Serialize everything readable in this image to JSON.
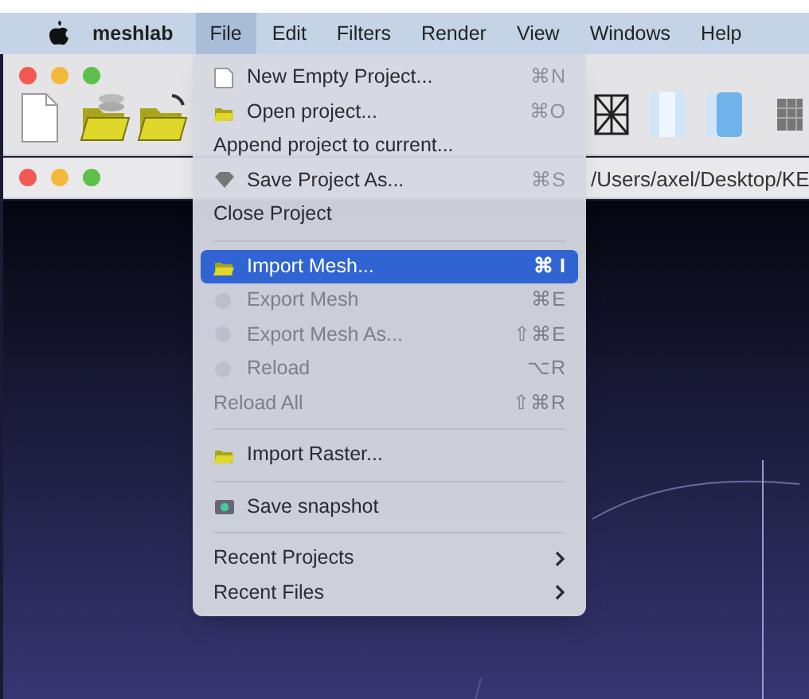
{
  "menu_bar": {
    "app_name": "meshlab",
    "items": [
      {
        "label": "File",
        "selected": true
      },
      {
        "label": "Edit",
        "selected": false
      },
      {
        "label": "Filters",
        "selected": false
      },
      {
        "label": "Render",
        "selected": false
      },
      {
        "label": "View",
        "selected": false
      },
      {
        "label": "Windows",
        "selected": false
      },
      {
        "label": "Help",
        "selected": false
      }
    ]
  },
  "document_window": {
    "path": "/Users/axel/Desktop/KE"
  },
  "file_menu": [
    {
      "kind": "icon_item",
      "label": "New Empty Project...",
      "shortcut": "⌘N",
      "disabled": false,
      "selected": false
    },
    {
      "kind": "icon_item",
      "label": "Open project...",
      "shortcut": "⌘O",
      "disabled": false,
      "selected": false
    },
    {
      "kind": "item",
      "label": "Append project to current...",
      "disabled": false,
      "selected": false
    },
    {
      "kind": "icon_item",
      "label": "Save Project As...",
      "shortcut": "⌘S",
      "disabled": false,
      "selected": false
    },
    {
      "kind": "item",
      "label": "Close Project",
      "disabled": false,
      "selected": false
    },
    {
      "kind": "separator"
    },
    {
      "kind": "icon_item",
      "label": "Import Mesh...",
      "shortcut": "⌘ I",
      "disabled": false,
      "selected": true
    },
    {
      "kind": "icon_item",
      "label": "Export Mesh",
      "shortcut": "⌘E",
      "disabled": true,
      "selected": false
    },
    {
      "kind": "icon_item",
      "label": "Export Mesh As...",
      "shortcut": "⇧⌘E",
      "disabled": true,
      "selected": false
    },
    {
      "kind": "icon_item",
      "label": "Reload",
      "shortcut": "⌥R",
      "disabled": true,
      "selected": false
    },
    {
      "kind": "item",
      "label": "Reload All",
      "shortcut": "⇧⌘R",
      "disabled": true,
      "selected": false
    },
    {
      "kind": "separator"
    },
    {
      "kind": "icon_item",
      "label": "Import Raster...",
      "disabled": false,
      "selected": false
    },
    {
      "kind": "separator"
    },
    {
      "kind": "icon_item",
      "label": "Save snapshot",
      "disabled": false,
      "selected": false
    },
    {
      "kind": "separator"
    },
    {
      "kind": "submenu",
      "label": "Recent Projects",
      "disabled": false,
      "selected": false
    },
    {
      "kind": "submenu",
      "label": "Recent Files",
      "disabled": false,
      "selected": false
    }
  ]
}
